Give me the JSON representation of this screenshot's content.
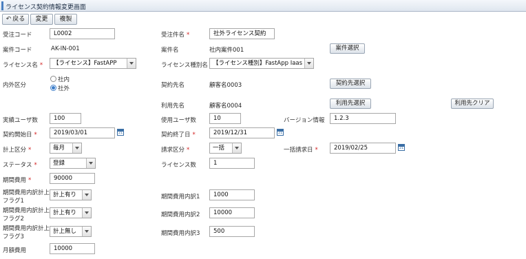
{
  "header": {
    "title": "ライセンス契約情報変更画面"
  },
  "toolbar": {
    "back_label": "戻る",
    "change_label": "変更",
    "copy_label": "複製"
  },
  "form": {
    "order_code_label": "受注コード",
    "order_code_value": "L0002",
    "order_name_label": "受注件名",
    "order_name_value": "社外ライセンス契約",
    "case_code_label": "案件コード",
    "case_code_value": "AK-IN-001",
    "case_name_label": "案件名",
    "case_name_value": "社内案件001",
    "case_select_button": "案件選択",
    "license_name_label": "ライセンス名",
    "license_name_value": "【ライセンス】FastAPP",
    "license_type_label": "ライセンス種別名",
    "license_type_value": "【ライセンス種別】FastApp Iaas",
    "inout_label": "内外区分",
    "inout_option_in": "社内",
    "inout_option_out": "社外",
    "contract_party_label": "契約先名",
    "contract_party_value": "顧客名0003",
    "contract_party_button": "契約先選択",
    "user_party_label": "利用先名",
    "user_party_value": "顧客名0004",
    "user_party_button": "利用先選択",
    "user_clear_button": "利用先クリア",
    "actual_users_label": "実績ユーザ数",
    "actual_users_value": "100",
    "used_users_label": "使用ユーザ数",
    "used_users_value": "10",
    "version_label": "バージョン情報",
    "version_value": "1.2.3",
    "start_date_label": "契約開始日",
    "start_date_value": "2019/03/01",
    "end_date_label": "契約終了日",
    "end_date_value": "2019/12/31",
    "calendar_glyph": "21",
    "accounting_label": "計上区分",
    "accounting_value": "毎月",
    "billing_label": "請求区分",
    "billing_value": "一括",
    "lump_date_label": "一括請求日",
    "lump_date_value": "2019/02/25",
    "status_label": "ステータス",
    "status_value": "登録",
    "license_count_label": "ライセンス数",
    "license_count_value": "1",
    "period_cost_label": "期間費用",
    "period_cost_value": "90000",
    "flag1_label_a": "期間費用内訳計上",
    "flag1_label_b": "フラグ1",
    "flag1_value": "計上有り",
    "detail1_label": "期間費用内訳1",
    "detail1_value": "1000",
    "flag2_label_a": "期間費用内訳計上",
    "flag2_label_b": "フラグ2",
    "flag2_value": "計上有り",
    "detail2_label": "期間費用内訳2",
    "detail2_value": "10000",
    "flag3_label_a": "期間費用内訳計上",
    "flag3_label_b": "フラグ3",
    "flag3_value": "計上無し",
    "detail3_label": "期間費用内訳3",
    "detail3_value": "500",
    "monthly_cost_label": "月額費用",
    "monthly_cost_value": "10000",
    "required_mark": "*"
  }
}
